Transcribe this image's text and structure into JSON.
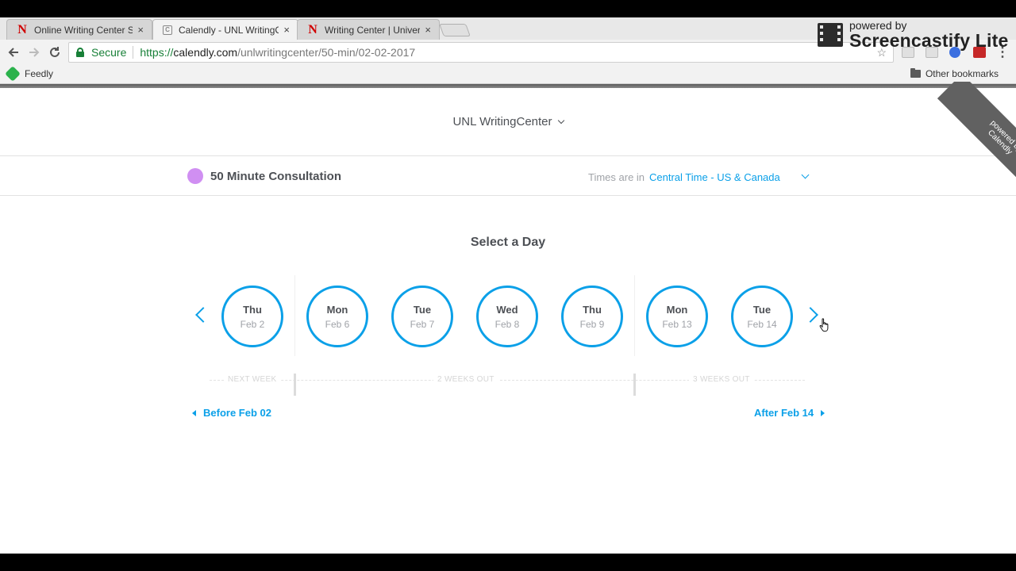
{
  "browser": {
    "tabs": [
      {
        "title": "Online Writing Center Se",
        "favicon": "N",
        "icon": "nebraska-n-icon",
        "active": false
      },
      {
        "title": "Calendly - UNL WritingC",
        "favicon": "C",
        "icon": "calendly-icon",
        "active": true
      },
      {
        "title": "Writing Center | Universi",
        "favicon": "N",
        "icon": "nebraska-n-icon",
        "active": false
      }
    ],
    "close_glyph": "×",
    "secure_label": "Secure",
    "url": {
      "scheme": "https://",
      "host": "calendly.com",
      "path": "/unlwritingcenter/50-min/02-02-2017"
    },
    "bookmarks": {
      "feedly": "Feedly",
      "other": "Other bookmarks"
    }
  },
  "watermark": {
    "small": "powered by",
    "big": "Screencastify Lite"
  },
  "calendly": {
    "org_name": "UNL WritingCenter",
    "ribbon_text": "powered by Calendly",
    "event_name": "50 Minute Consultation",
    "event_color": "#d08ff2",
    "timezone_label": "Times are in",
    "timezone_value": "Central Time - US & Canada",
    "select_title": "Select a Day",
    "accent_color": "#0ba0e8",
    "days": [
      {
        "dow": "Thu",
        "date": "Feb 2"
      },
      {
        "dow": "Mon",
        "date": "Feb 6"
      },
      {
        "dow": "Tue",
        "date": "Feb 7"
      },
      {
        "dow": "Wed",
        "date": "Feb 8"
      },
      {
        "dow": "Thu",
        "date": "Feb 9"
      },
      {
        "dow": "Mon",
        "date": "Feb 13"
      },
      {
        "dow": "Tue",
        "date": "Feb 14"
      }
    ],
    "week_groups": [
      "NEXT WEEK",
      "2 WEEKS OUT",
      "3 WEEKS OUT"
    ],
    "before_label": "Before Feb 02",
    "after_label": "After Feb 14"
  }
}
